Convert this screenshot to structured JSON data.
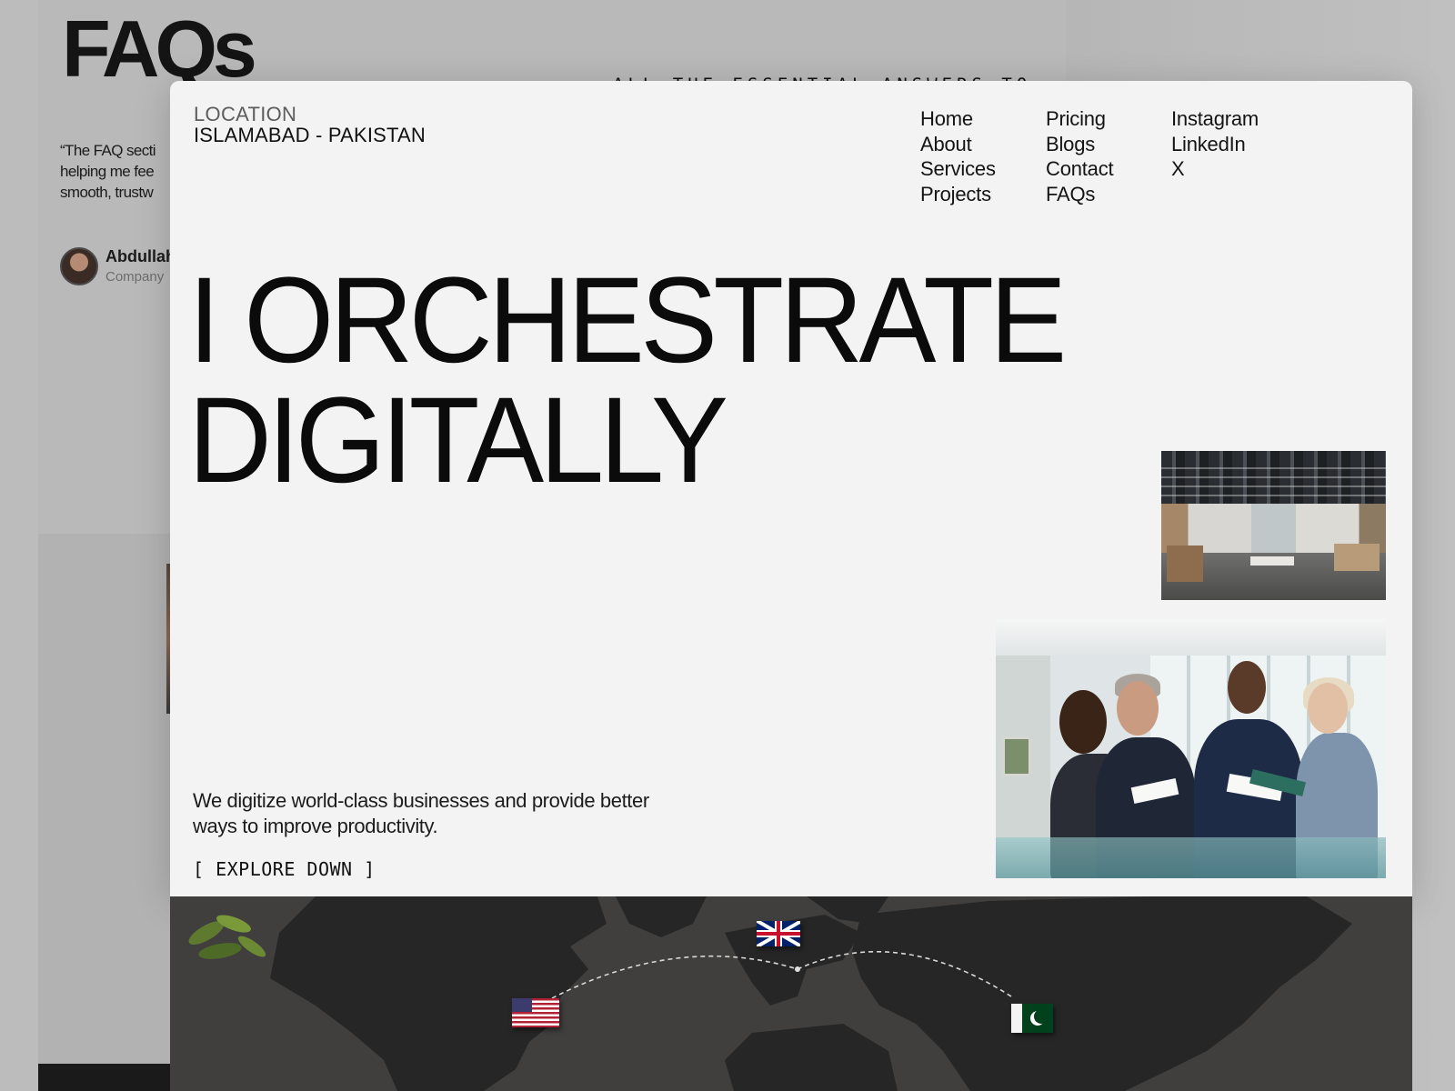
{
  "background_page": {
    "title": "FAQs",
    "tagline": "ALL THE ESSENTIAL ANSWERS TO",
    "quote": "“The FAQ secti\nhelping me fee\nsmooth, trustw",
    "author_name": "Abdullah",
    "author_company": "Company"
  },
  "hero": {
    "location_label": "LOCATION",
    "location_value": "ISLAMABAD - PAKISTAN",
    "title_line1": "I ORCHESTRATE",
    "title_line2": "DIGITALLY",
    "description": "We digitize world-class businesses and provide better ways to improve productivity.",
    "cta": "[ EXPLORE DOWN ]"
  },
  "nav": {
    "col1": [
      "Home",
      "About",
      "Services",
      "Projects"
    ],
    "col2": [
      "Pricing",
      "Blogs",
      "Contact",
      "FAQs"
    ],
    "col3": [
      "Instagram",
      "LinkedIn",
      "X"
    ]
  },
  "colors": {
    "card_background": "#f3f3f3",
    "text": "#0b0b0b",
    "map": "#3f3f3e"
  }
}
